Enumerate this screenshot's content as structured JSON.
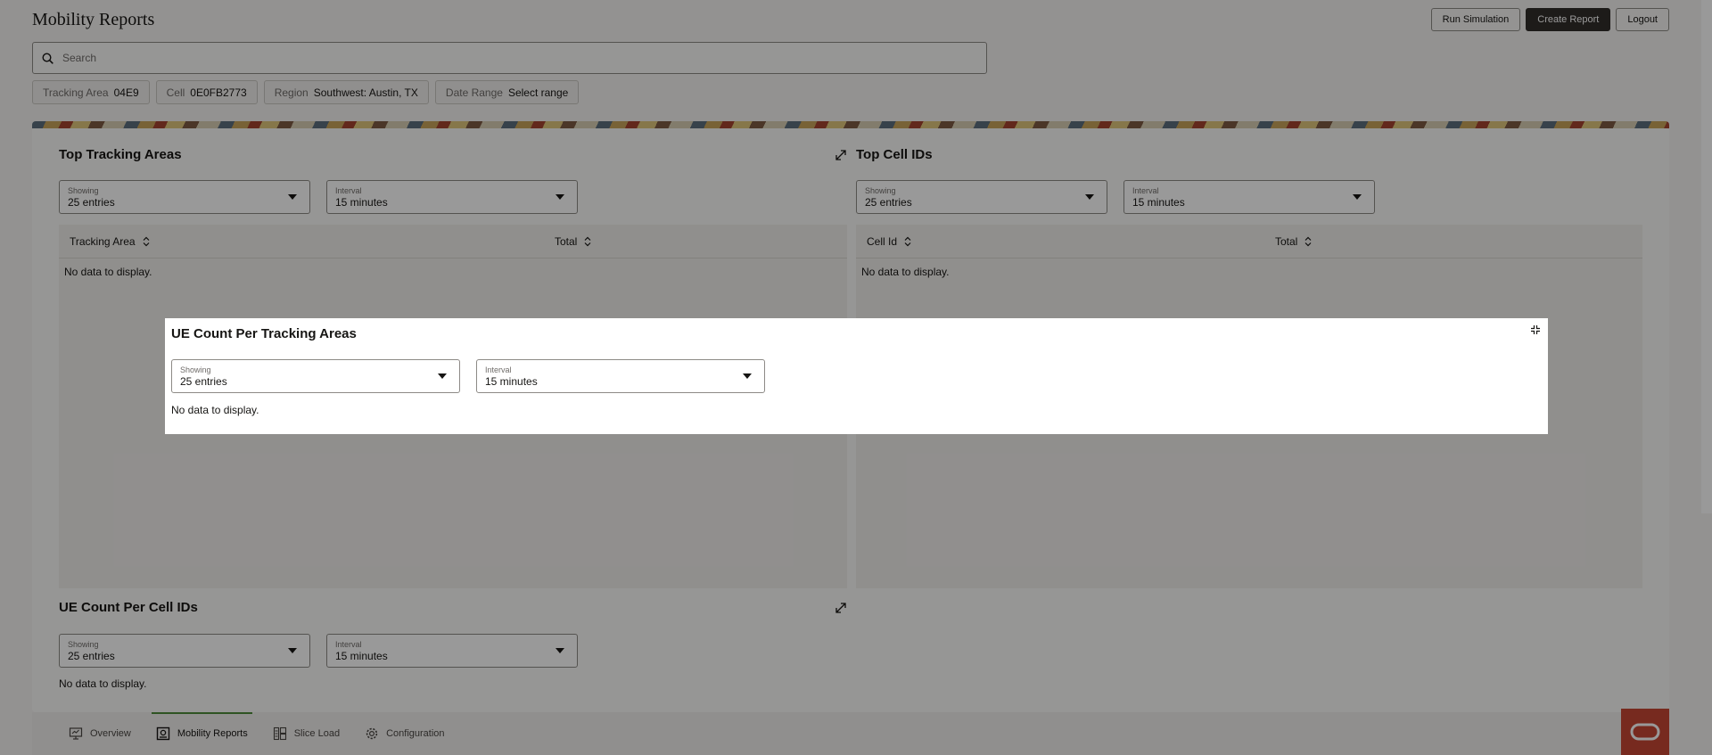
{
  "app": {
    "title": "Mobility Reports"
  },
  "header": {
    "run_simulation": "Run Simulation",
    "create_report": "Create Report",
    "logout": "Logout"
  },
  "search": {
    "placeholder": "Search"
  },
  "filters": [
    {
      "label": "Tracking Area",
      "value": "04E9"
    },
    {
      "label": "Cell",
      "value": "0E0FB2773"
    },
    {
      "label": "Region",
      "value": "Southwest: Austin, TX"
    },
    {
      "label": "Date Range",
      "value": "Select range"
    }
  ],
  "top_tracking_areas": {
    "title": "Top Tracking Areas",
    "showing_label": "Showing",
    "showing_value": "25 entries",
    "interval_label": "Interval",
    "interval_value": "15 minutes",
    "columns": [
      "Tracking Area",
      "Total"
    ],
    "empty_text": "No data to display."
  },
  "top_cell_ids": {
    "title": "Top Cell IDs",
    "showing_label": "Showing",
    "showing_value": "25 entries",
    "interval_label": "Interval",
    "interval_value": "15 minutes",
    "columns": [
      "Cell Id",
      "Total"
    ],
    "empty_text": "No data to display."
  },
  "ue_count_cell_ids": {
    "title": "UE Count Per Cell IDs",
    "showing_label": "Showing",
    "showing_value": "25 entries",
    "interval_label": "Interval",
    "interval_value": "15 minutes",
    "empty_text": "No data to display."
  },
  "dialog": {
    "title": "UE Count Per Tracking Areas",
    "showing_label": "Showing",
    "showing_value": "25 entries",
    "interval_label": "Interval",
    "interval_value": "15 minutes",
    "empty_text": "No data to display."
  },
  "bottom_nav": [
    {
      "label": "Overview",
      "icon": "monitor-icon"
    },
    {
      "label": "Mobility Reports",
      "icon": "report-icon",
      "active": true
    },
    {
      "label": "Slice Load",
      "icon": "grid-icon"
    },
    {
      "label": "Configuration",
      "icon": "gear-icon"
    }
  ],
  "colors": {
    "primary_button": "#312d2a",
    "active_tab_accent": "#4d8b3a",
    "brand": "#c74634"
  }
}
